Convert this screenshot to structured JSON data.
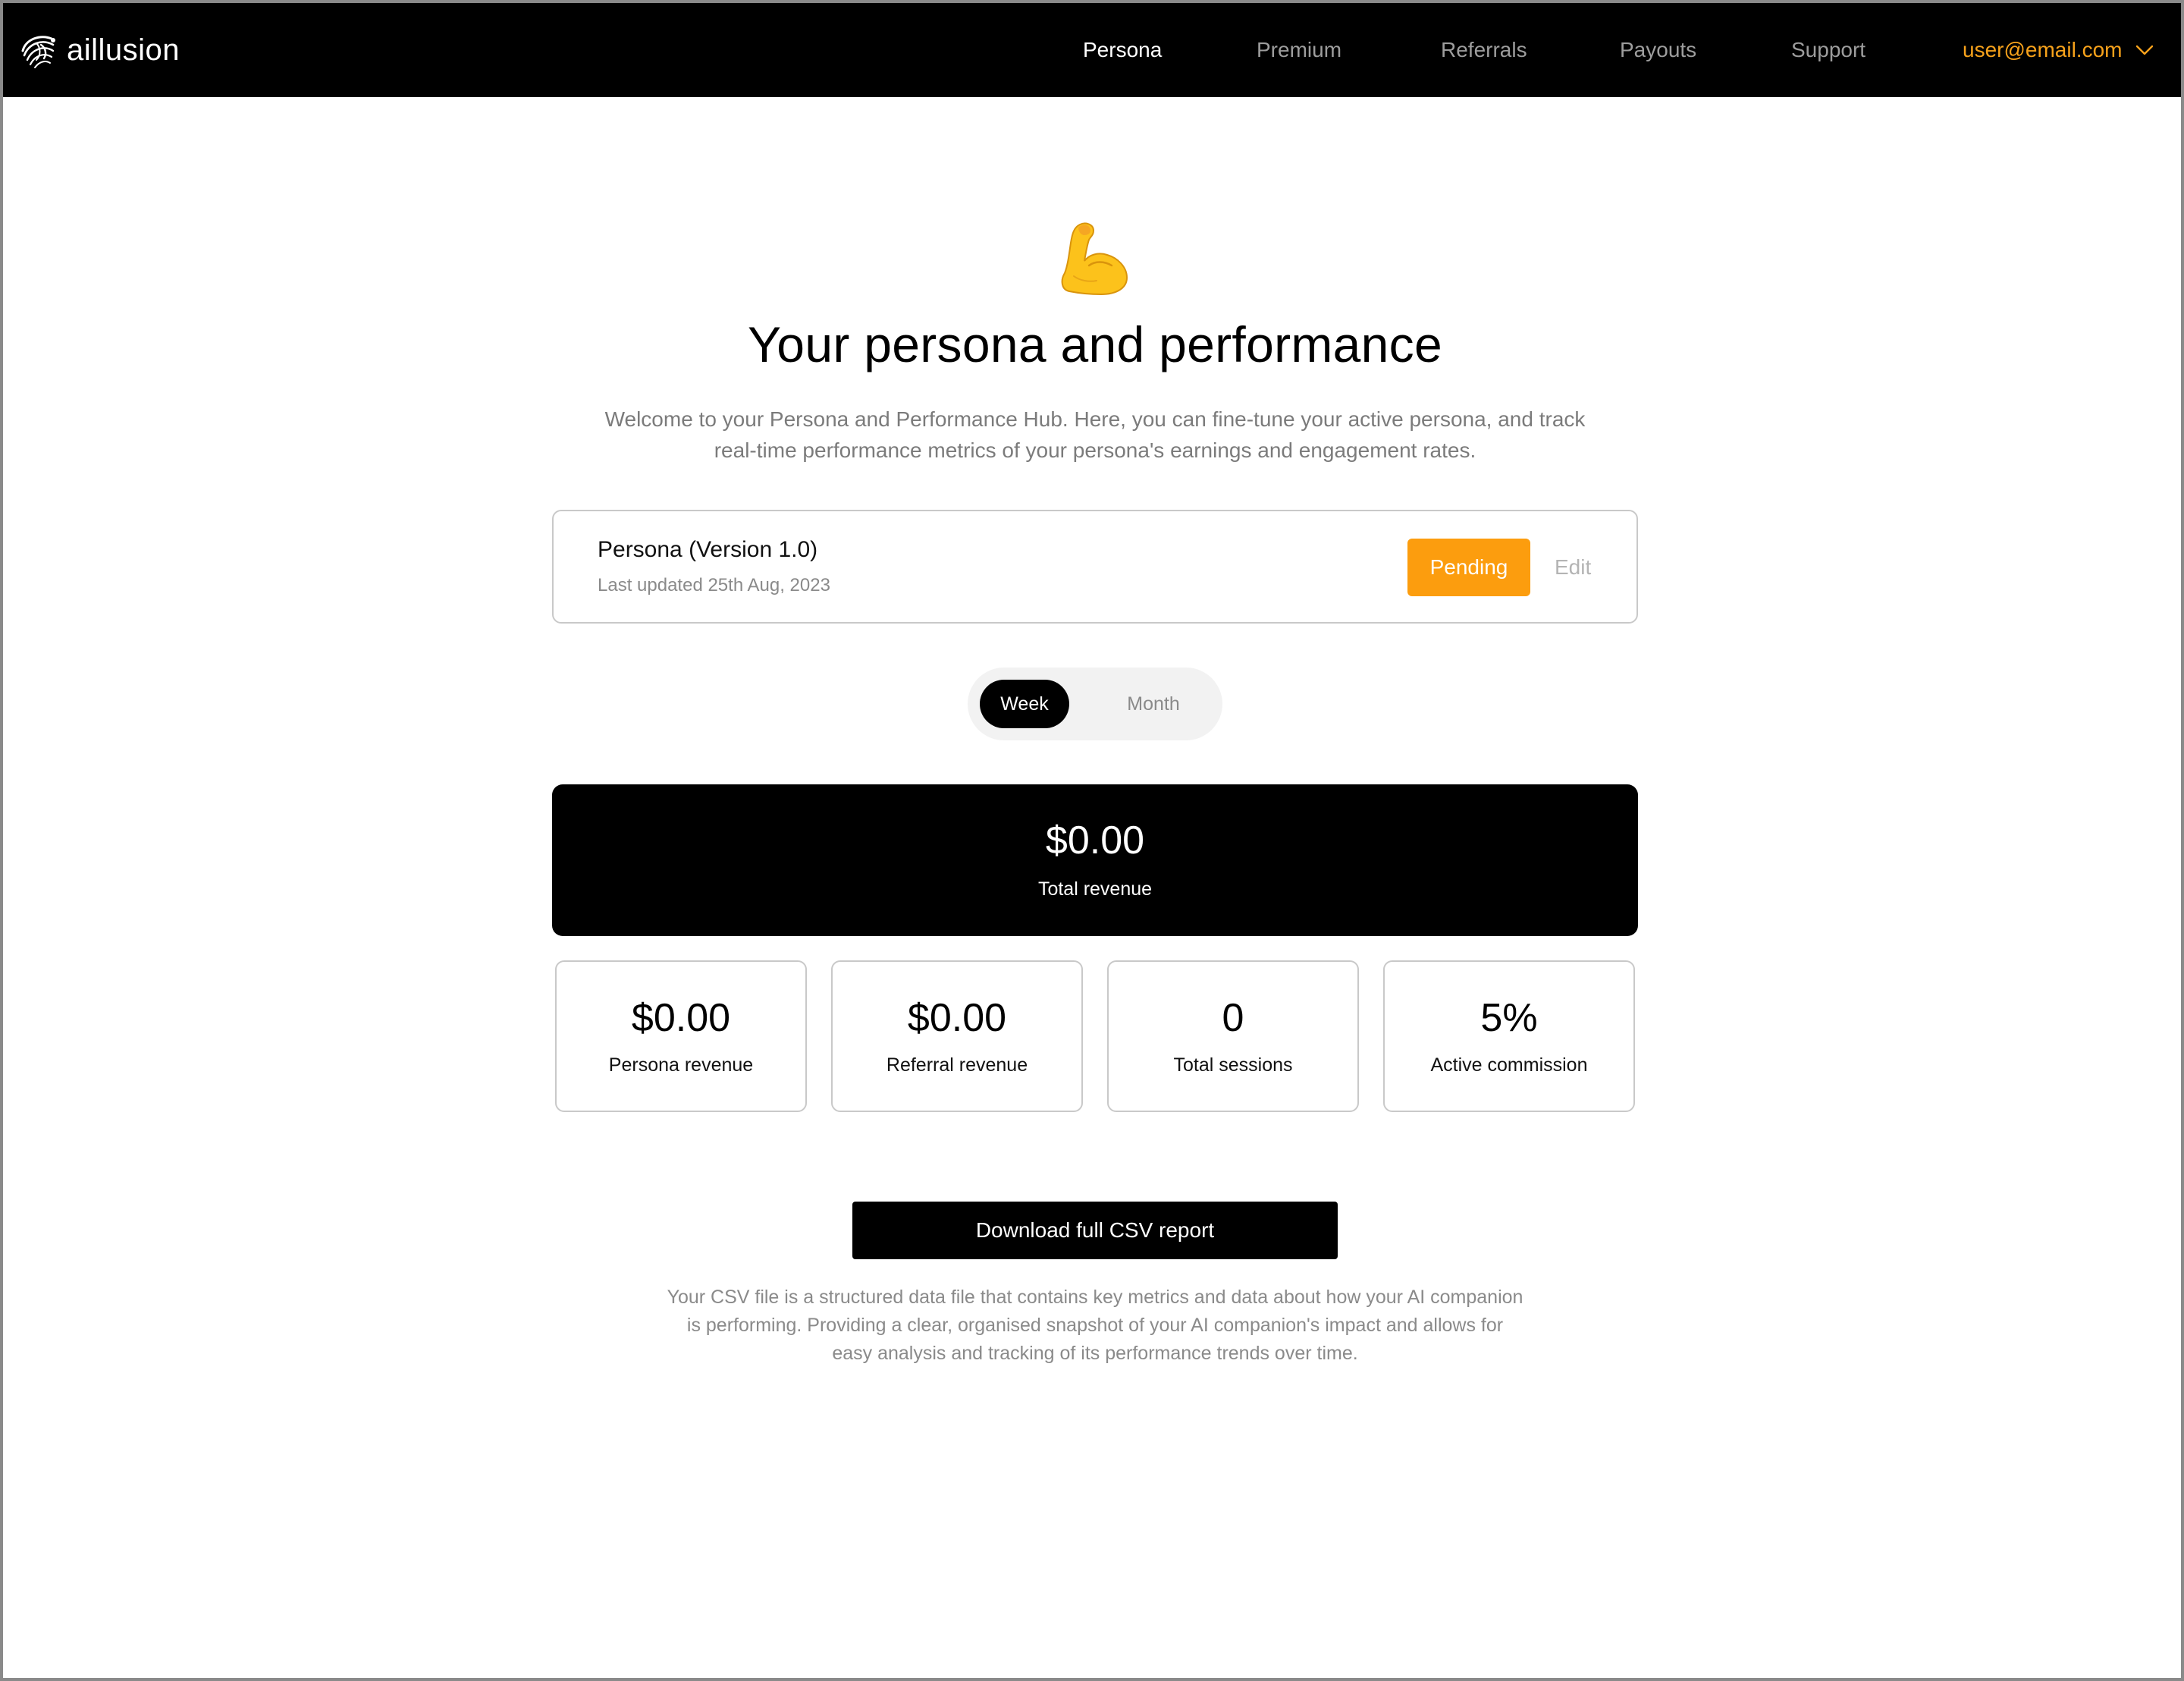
{
  "colors": {
    "nav_background": "#000000",
    "accent_orange": "#fc9d0e",
    "email_orange": "#f7a21b",
    "muted_text": "#7b7b7b",
    "card_border": "#c9c9c9"
  },
  "header": {
    "logo_icon": "aillusion-swirl-logo",
    "brand_name": "aillusion",
    "nav": {
      "persona": "Persona",
      "premium": "Premium",
      "referrals": "Referrals",
      "payouts": "Payouts",
      "support": "Support"
    },
    "active_nav": "Persona",
    "user_email": "user@email.com",
    "user_menu_icon": "chevron-down-icon"
  },
  "hero": {
    "emoji_icon": "flexed-biceps-icon",
    "title": "Your persona and performance",
    "subtitle_line1": "Welcome to your Persona and Performance Hub. Here, you can fine-tune your active persona, and track",
    "subtitle_line2": "real-time performance metrics of your persona's earnings and engagement rates."
  },
  "persona_card": {
    "title": "Persona (Version 1.0)",
    "last_updated": "Last updated 25th Aug, 2023",
    "status": "Pending",
    "edit_label": "Edit"
  },
  "period_toggle": {
    "week": "Week",
    "month": "Month",
    "selected": "Week"
  },
  "total": {
    "value": "$0.00",
    "label": "Total revenue"
  },
  "stats": [
    {
      "value": "$0.00",
      "label": "Persona revenue"
    },
    {
      "value": "$0.00",
      "label": "Referral revenue"
    },
    {
      "value": "0",
      "label": "Total sessions"
    },
    {
      "value": "5%",
      "label": "Active commission"
    }
  ],
  "download": {
    "button_label": "Download full CSV report",
    "note_line1": "Your CSV file is a structured data file that contains key metrics and data about how your AI companion",
    "note_line2": "is performing. Providing a clear, organised snapshot of your AI companion's impact and allows for",
    "note_line3": "easy analysis and tracking of its performance trends over time."
  }
}
